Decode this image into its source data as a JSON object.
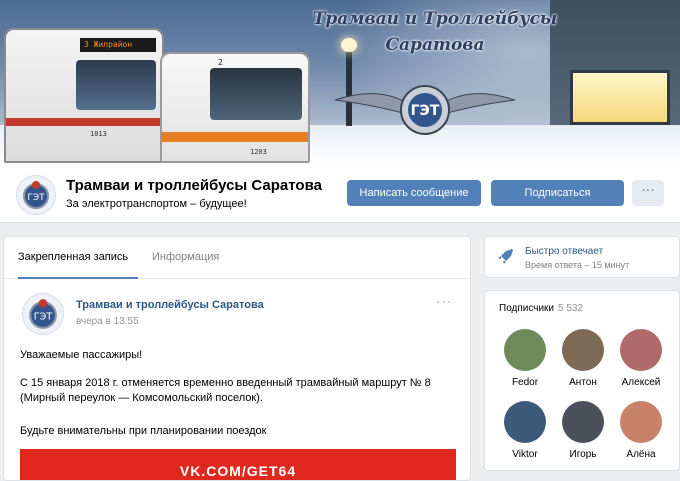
{
  "banner": {
    "title_line1": "Трамваи и Троллейбусы",
    "title_line2": "Саратова",
    "tram_route": "3  Жилрайон",
    "tram_number": "1013",
    "trolley_route": "2",
    "trolley_number": "1203"
  },
  "header": {
    "group_name": "Трамваи и троллейбусы Саратова",
    "status": "За электротранспортом – будущее!",
    "message_button": "Написать сообщение",
    "subscribe_button": "Подписаться",
    "more_button": "···"
  },
  "tabs": {
    "pinned": "Закрепленная запись",
    "info": "Информация"
  },
  "post": {
    "author": "Трамваи и троллейбусы Саратова",
    "date": "вчера в 13:55",
    "more": "···",
    "greeting": "Уважаемые пассажиры!",
    "body": "С 15 января 2018 г. отменяется временно введенный трамвайный маршрут № 8 (Мирный переулок — Комсомольский поселок).",
    "note": "Будьте внимательны при планировании поездок",
    "banner_text": "VK.COM/GET64"
  },
  "reply": {
    "title": "Быстро отвечает",
    "subtitle": "Время ответа – 15 минут"
  },
  "subscribers": {
    "title": "Подписчики",
    "count": "5 532",
    "people": [
      {
        "name": "Fedor",
        "color": "#6f8a5a"
      },
      {
        "name": "Антон",
        "color": "#7d6a55"
      },
      {
        "name": "Алексей",
        "color": "#b06a6a"
      },
      {
        "name": "Viktor",
        "color": "#3d5a7a"
      },
      {
        "name": "Игорь",
        "color": "#4a4f5a"
      },
      {
        "name": "Алёна",
        "color": "#c8826a"
      }
    ]
  },
  "colors": {
    "accent": "#5181b8",
    "link": "#2a5885",
    "banner_red": "#e0281e"
  }
}
